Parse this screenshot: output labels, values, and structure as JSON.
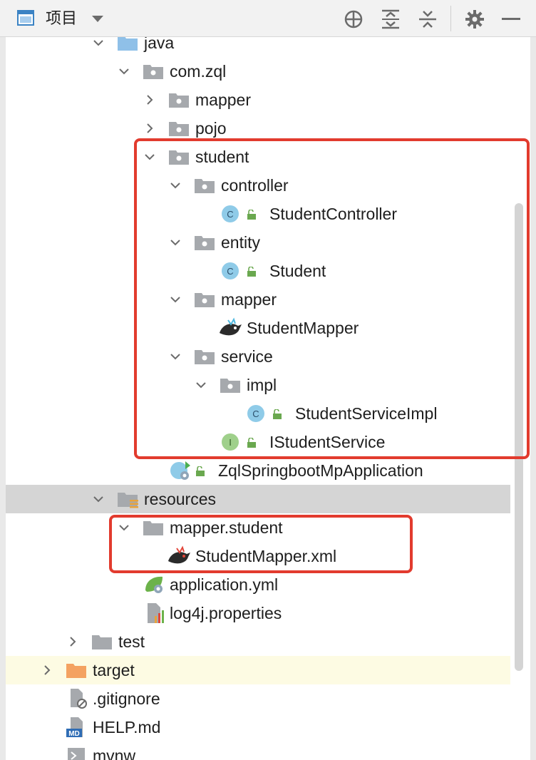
{
  "toolbar": {
    "title": "项目",
    "icons": [
      "project-view-icon",
      "dropdown-arrow-icon",
      "locate-target-icon",
      "expand-all-icon",
      "collapse-all-icon",
      "gear-icon",
      "hide-icon"
    ]
  },
  "tree": {
    "rows": [
      {
        "label": "java"
      },
      {
        "label": "com.zql"
      },
      {
        "label": "mapper"
      },
      {
        "label": "pojo"
      },
      {
        "label": "student"
      },
      {
        "label": "controller"
      },
      {
        "label": "StudentController"
      },
      {
        "label": "entity"
      },
      {
        "label": "Student"
      },
      {
        "label": "mapper"
      },
      {
        "label": "StudentMapper"
      },
      {
        "label": "service"
      },
      {
        "label": "impl"
      },
      {
        "label": "StudentServiceImpl"
      },
      {
        "label": "IStudentService"
      },
      {
        "label": "ZqlSpringbootMpApplication"
      },
      {
        "label": "resources"
      },
      {
        "label": "mapper.student"
      },
      {
        "label": "StudentMapper.xml"
      },
      {
        "label": "application.yml"
      },
      {
        "label": "log4j.properties"
      },
      {
        "label": "test"
      },
      {
        "label": "target"
      },
      {
        "label": ".gitignore"
      },
      {
        "label": "HELP.md"
      },
      {
        "label": "mvnw"
      }
    ]
  },
  "glyphs": {
    "class": "C",
    "interface": "I",
    "markdown": "MD"
  },
  "colors": {
    "highlight_box": "#e23b2e",
    "selected_row": "#d5d5d5",
    "target_row": "#fdfbe3"
  }
}
